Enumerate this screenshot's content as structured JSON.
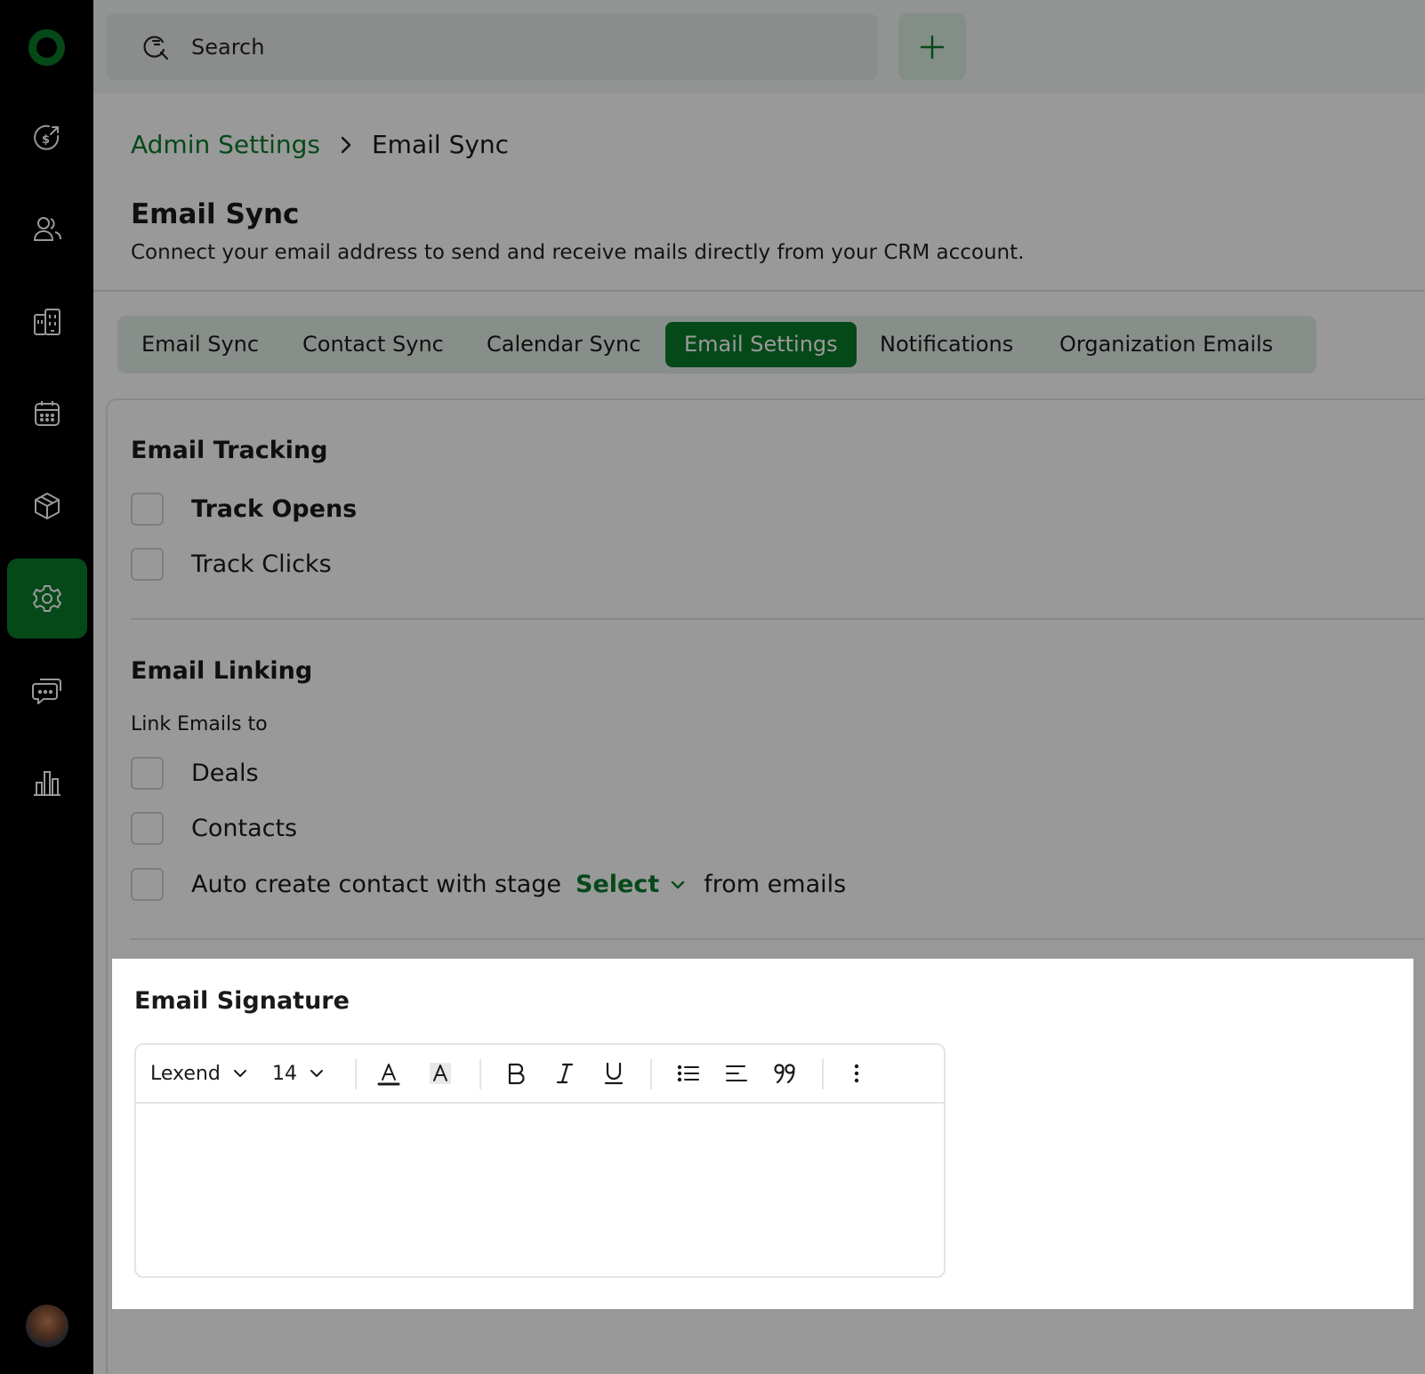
{
  "search": {
    "label": "Search"
  },
  "breadcrumb": {
    "parent": "Admin Settings",
    "current": "Email Sync"
  },
  "page": {
    "title": "Email Sync",
    "description": "Connect your email address to send and receive mails directly from your CRM account."
  },
  "tabs": [
    {
      "label": "Email Sync"
    },
    {
      "label": "Contact Sync"
    },
    {
      "label": "Calendar Sync"
    },
    {
      "label": "Email Settings",
      "active": true
    },
    {
      "label": "Notifications"
    },
    {
      "label": "Organization Emails"
    }
  ],
  "tracking": {
    "title": "Email Tracking",
    "opens": {
      "label": "Track Opens",
      "checked": false
    },
    "clicks": {
      "label": "Track Clicks",
      "checked": false
    }
  },
  "linking": {
    "title": "Email Linking",
    "sub_label": "Link Emails to",
    "deals": {
      "label": "Deals",
      "checked": false
    },
    "contacts": {
      "label": "Contacts",
      "checked": false
    },
    "auto_create": {
      "prefix": "Auto create contact with stage",
      "select": "Select",
      "suffix": "from emails",
      "checked": false
    }
  },
  "signature": {
    "title": "Email Signature",
    "font": "Lexend",
    "size": "14",
    "content": ""
  },
  "colors": {
    "accent": "#0b7a2a",
    "sidebar": "#000000",
    "tab_bg": "#e3efe6",
    "overlay": "rgba(0,0,0,0.4)"
  },
  "icons": {
    "sidebar": [
      "logo-icon",
      "deals-dollar-icon",
      "contacts-icon",
      "companies-building-icon",
      "calendar-icon",
      "products-box-icon",
      "settings-gear-icon",
      "chat-icon",
      "reports-chart-icon"
    ],
    "toolbar": [
      "text-color-icon",
      "highlight-color-icon",
      "bold-icon",
      "italic-icon",
      "underline-icon",
      "bullet-list-icon",
      "align-left-icon",
      "quote-icon",
      "more-vertical-icon"
    ]
  }
}
